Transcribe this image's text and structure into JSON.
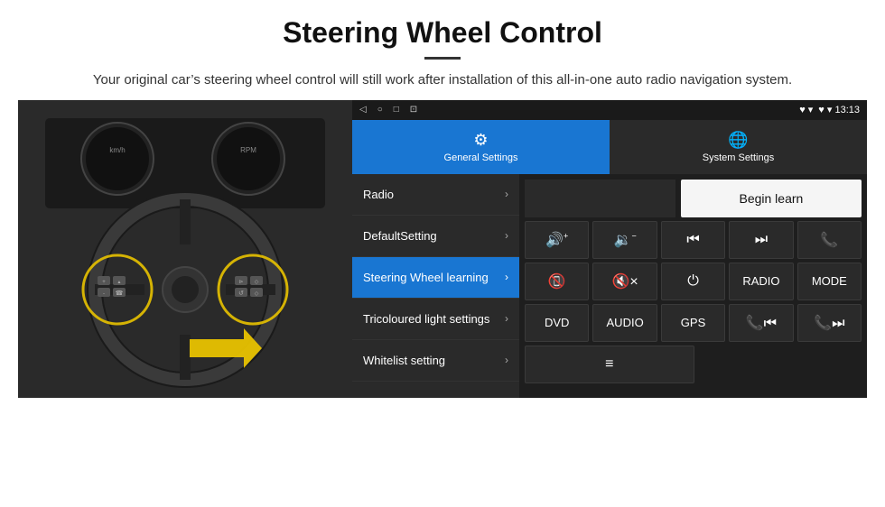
{
  "header": {
    "title": "Steering Wheel Control",
    "subtitle": "Your original car’s steering wheel control will still work after installation of this all-in-one auto radio navigation system."
  },
  "statusBar": {
    "icons": [
      "◁",
      "○",
      "□",
      "⊡"
    ],
    "right": "♥ ▾  13:13"
  },
  "navTabs": [
    {
      "id": "general",
      "label": "General Settings",
      "icon": "⚙",
      "active": true
    },
    {
      "id": "system",
      "label": "System Settings",
      "icon": "🌐",
      "active": false
    }
  ],
  "sidebar": {
    "items": [
      {
        "id": "radio",
        "label": "Radio",
        "active": false
      },
      {
        "id": "default",
        "label": "DefaultSetting",
        "active": false
      },
      {
        "id": "steering",
        "label": "Steering Wheel learning",
        "active": true
      },
      {
        "id": "tricoloured",
        "label": "Tricoloured light settings",
        "active": false
      },
      {
        "id": "whitelist",
        "label": "Whitelist setting",
        "active": false
      }
    ]
  },
  "controlPanel": {
    "beginLearn": "Begin learn",
    "rows": [
      [
        {
          "id": "vol-up",
          "label": "🔊+",
          "type": "icon"
        },
        {
          "id": "vol-down",
          "label": "🔉−",
          "type": "icon"
        },
        {
          "id": "prev",
          "label": "⏮",
          "type": "icon"
        },
        {
          "id": "next",
          "label": "⏭",
          "type": "icon"
        },
        {
          "id": "phone",
          "label": "📞",
          "type": "icon"
        }
      ],
      [
        {
          "id": "hangup",
          "label": "📵",
          "type": "icon"
        },
        {
          "id": "mute",
          "label": "🔇×",
          "type": "icon"
        },
        {
          "id": "power",
          "label": "⏻",
          "type": "icon"
        },
        {
          "id": "radio-btn",
          "label": "RADIO",
          "type": "text"
        },
        {
          "id": "mode",
          "label": "MODE",
          "type": "text"
        }
      ],
      [
        {
          "id": "dvd",
          "label": "DVD",
          "type": "text"
        },
        {
          "id": "audio",
          "label": "AUDIO",
          "type": "text"
        },
        {
          "id": "gps",
          "label": "GPS",
          "type": "text"
        },
        {
          "id": "tel-prev",
          "label": "📞⏮",
          "type": "icon"
        },
        {
          "id": "tel-next",
          "label": "📞⏭",
          "type": "icon"
        }
      ]
    ],
    "extraRow": [
      {
        "id": "list",
        "label": "≡",
        "type": "icon"
      }
    ]
  }
}
